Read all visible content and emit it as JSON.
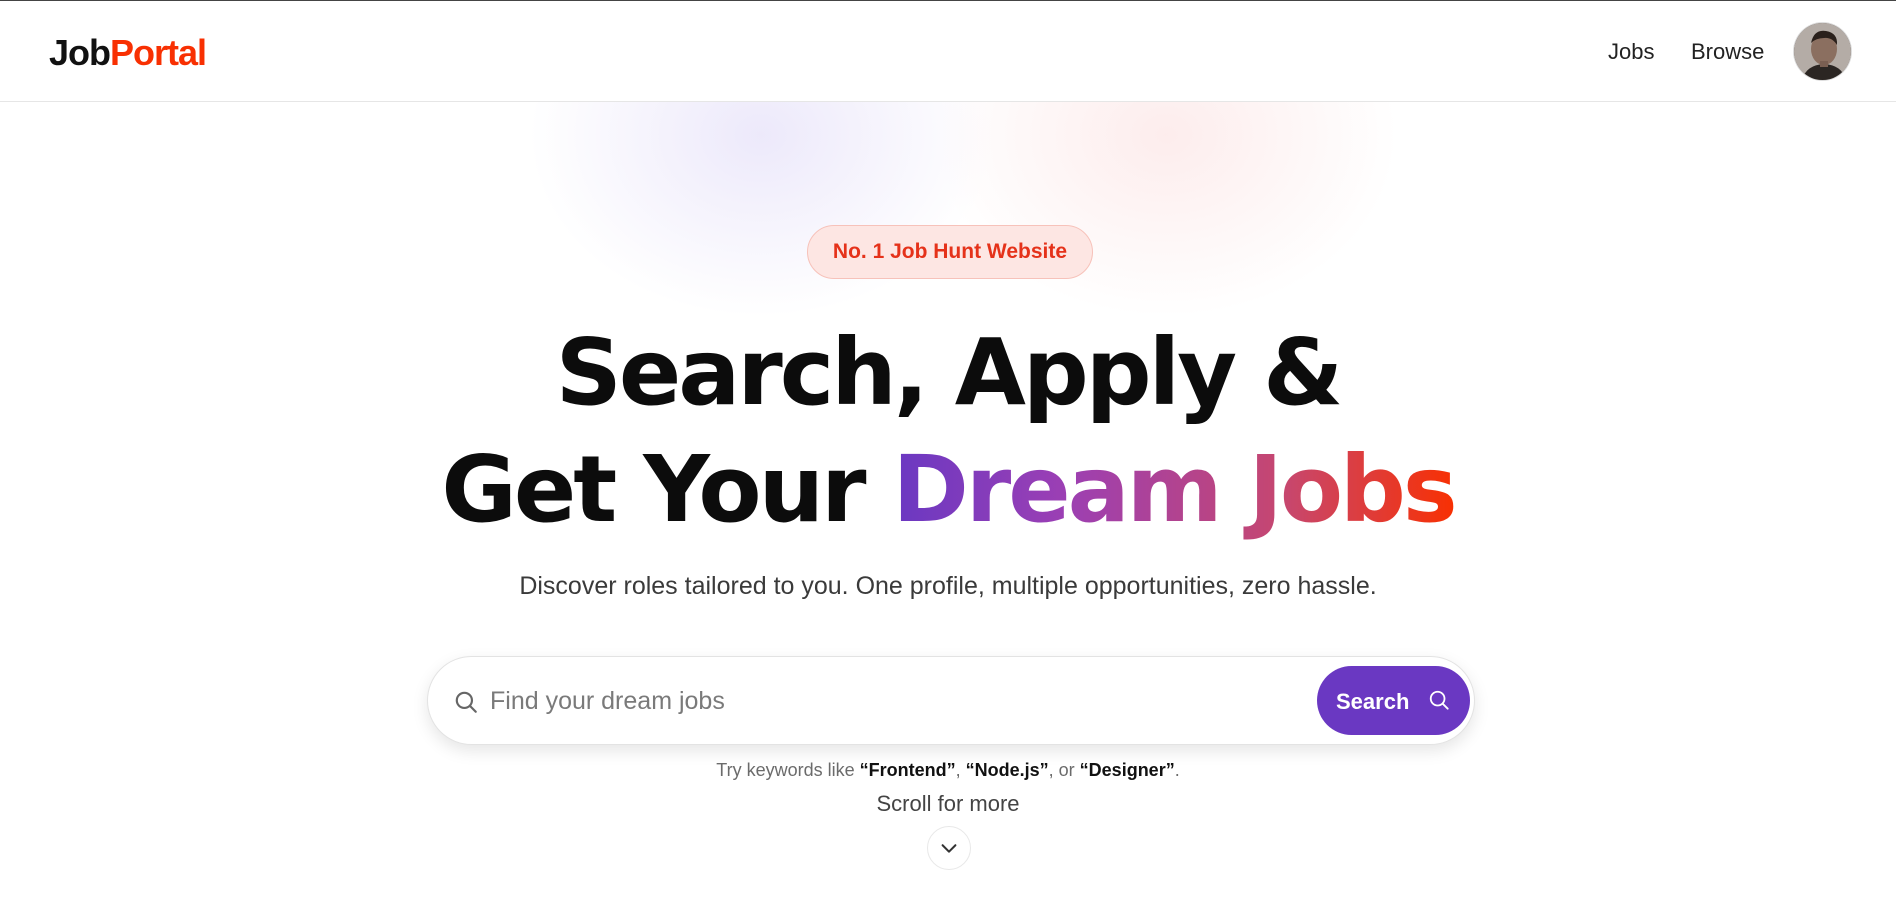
{
  "header": {
    "logo_part1": "Job",
    "logo_part2": "Portal",
    "nav": {
      "jobs": "Jobs",
      "browse": "Browse"
    }
  },
  "hero": {
    "badge": "No. 1 Job Hunt Website",
    "headline_line1": "Search, Apply &",
    "headline_line2_plain": "Get Your ",
    "headline_line2_highlight": "Dream Jobs",
    "subtitle": "Discover roles tailored to you. One profile, multiple opportunities, zero hassle."
  },
  "search": {
    "placeholder": "Find your dream jobs",
    "value": "",
    "button_label": "Search"
  },
  "hint": {
    "prefix": "Try keywords like ",
    "kw1": "“Frontend”",
    "sep1": ", ",
    "kw2": "“Node.js”",
    "sep2": ", or ",
    "kw3": "“Designer”",
    "suffix": "."
  },
  "scroll_label": "Scroll for more",
  "colors": {
    "brand_red": "#f83002",
    "brand_purple": "#6a38c2"
  },
  "icons": {
    "search": "search-icon",
    "chevron": "chevron-down-icon",
    "avatar": "user-avatar"
  }
}
